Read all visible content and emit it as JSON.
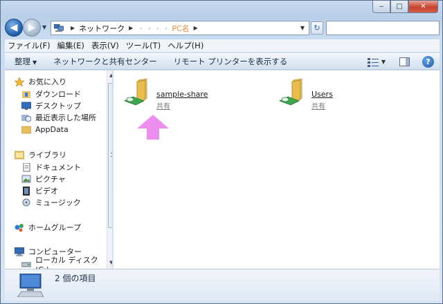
{
  "window": {
    "caption": {
      "minimize": "‒",
      "maximize": "□",
      "close": "✕"
    }
  },
  "navbar": {
    "back_icon": "back-arrow-icon",
    "forward_icon": "forward-arrow-icon",
    "address": {
      "root": "ネットワーク",
      "pc_name_prefix": "・・・・",
      "pc_name": "PC名"
    },
    "search_placeholder": ""
  },
  "menubar": {
    "items": [
      "ファイル(F)",
      "編集(E)",
      "表示(V)",
      "ツール(T)",
      "ヘルプ(H)"
    ]
  },
  "commandbar": {
    "organize": "整理",
    "network_center": "ネットワークと共有センター",
    "remote_printers": "リモート プリンターを表示する"
  },
  "navpane": {
    "favorites": "お気に入り",
    "favorites_items": [
      "ダウンロード",
      "デスクトップ",
      "最近表示した場所",
      "AppData"
    ],
    "libraries": "ライブラリ",
    "libraries_items": [
      "ドキュメント",
      "ピクチャ",
      "ビデオ",
      "ミュージック"
    ],
    "homegroup": "ホームグループ",
    "computer": "コンピューター",
    "computer_items": [
      "ローカル ディスク (C:)"
    ]
  },
  "content": {
    "items": [
      {
        "name": "sample-share",
        "subtitle": "共有"
      },
      {
        "name": "Users",
        "subtitle": "共有"
      }
    ],
    "annotation_color": "#ee8df0"
  },
  "details": {
    "count_text": "2 個の項目"
  },
  "colors": {
    "pc_name": "#f08a37",
    "accent": "#1d5ba8",
    "close_button": "#c8412c"
  }
}
